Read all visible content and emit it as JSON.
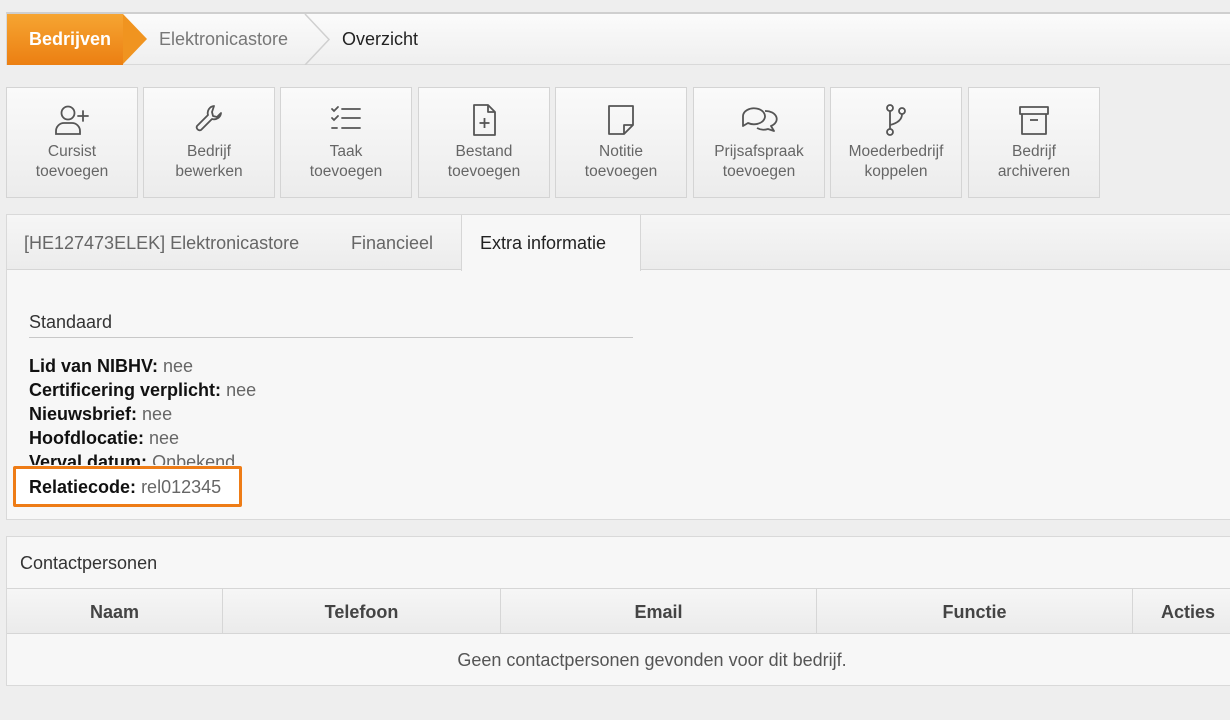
{
  "breadcrumb": {
    "items": [
      "Bedrijven",
      "Elektronicastore",
      "Overzicht"
    ]
  },
  "toolbar": {
    "buttons": [
      {
        "line1": "Cursist",
        "line2": "toevoegen",
        "icon": "add-user-icon"
      },
      {
        "line1": "Bedrijf",
        "line2": "bewerken",
        "icon": "wrench-icon"
      },
      {
        "line1": "Taak",
        "line2": "toevoegen",
        "icon": "checklist-icon"
      },
      {
        "line1": "Bestand",
        "line2": "toevoegen",
        "icon": "file-plus-icon"
      },
      {
        "line1": "Notitie",
        "line2": "toevoegen",
        "icon": "note-icon"
      },
      {
        "line1": "Prijsafspraak",
        "line2": "toevoegen",
        "icon": "chat-bubbles-icon"
      },
      {
        "line1": "Moederbedrijf",
        "line2": "koppelen",
        "icon": "branch-icon"
      },
      {
        "line1": "Bedrijf",
        "line2": "archiveren",
        "icon": "archive-box-icon"
      }
    ]
  },
  "tabs": [
    "[HE127473ELEK] Elektronicastore",
    "Financieel",
    "Extra informatie"
  ],
  "section": {
    "title": "Standaard",
    "fields": [
      {
        "label": "Lid van NIBHV:",
        "value": "nee"
      },
      {
        "label": "Certificering verplicht:",
        "value": "nee"
      },
      {
        "label": "Nieuwsbrief:",
        "value": "nee"
      },
      {
        "label": "Hoofdlocatie:",
        "value": "nee"
      },
      {
        "label": "Verval datum:",
        "value": "Onbekend"
      },
      {
        "label": "Relatiecode:",
        "value": "rel012345"
      }
    ]
  },
  "contacts": {
    "title": "Contactpersonen",
    "columns": [
      "Naam",
      "Telefoon",
      "Email",
      "Functie",
      "Acties"
    ],
    "empty_message": "Geen contactpersonen gevonden voor dit bedrijf."
  },
  "colors": {
    "accent": "#ee7c16",
    "highlight_border": "#ee7c16"
  }
}
